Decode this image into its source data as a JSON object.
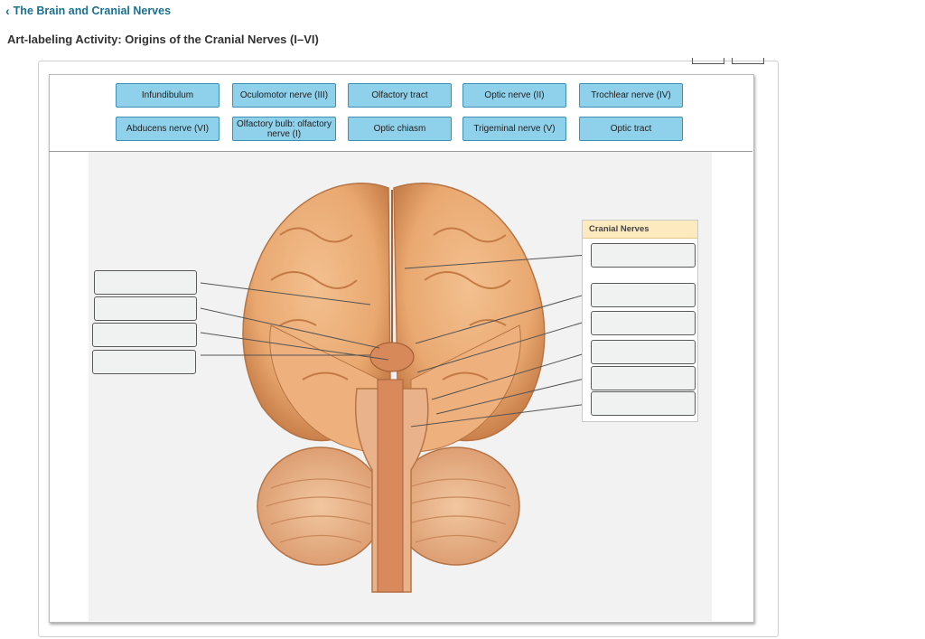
{
  "nav": {
    "back_label": "The Brain and Cranial Nerves"
  },
  "activity": {
    "title": "Art-labeling Activity: Origins of the Cranial Nerves (I–VI)"
  },
  "label_bank": {
    "row1": [
      "Infundibulum",
      "Oculomotor nerve (III)",
      "Olfactory tract",
      "Optic nerve (II)",
      "Trochlear nerve (IV)"
    ],
    "row2": [
      "Abducens nerve (VI)",
      "Olfactory bulb: olfactory nerve (I)",
      "Optic chiasm",
      "Trigeminal nerve (V)",
      "Optic tract"
    ]
  },
  "cranial_nerves_panel": {
    "header": "Cranial Nerves"
  },
  "colors": {
    "accent": "#1b6f8f",
    "chip_fill": "#8fd0ea",
    "chip_border": "#3f8fb4",
    "panel_header": "#fdebbf",
    "brain_tissue": "#e9a870"
  }
}
